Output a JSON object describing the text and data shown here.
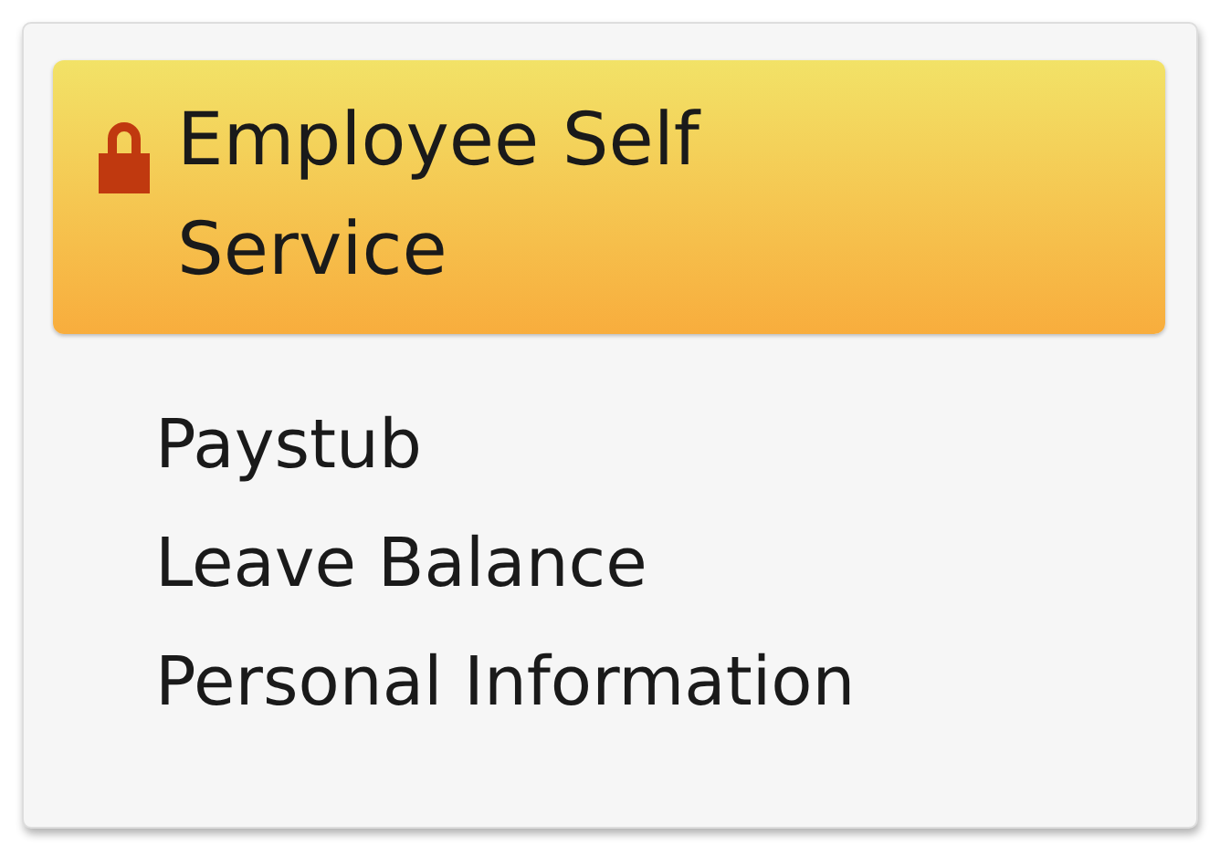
{
  "panel": {
    "title": "Employee Self Service",
    "items": [
      {
        "label": "Paystub"
      },
      {
        "label": "Leave Balance"
      },
      {
        "label": "Personal Information"
      }
    ]
  }
}
